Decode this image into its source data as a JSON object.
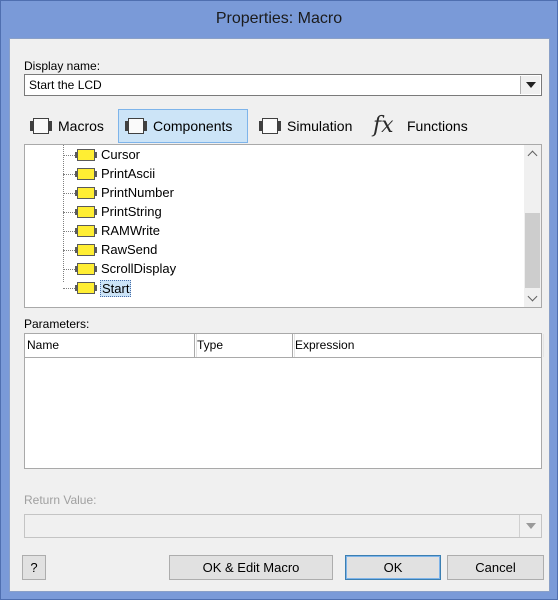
{
  "window": {
    "title": "Properties: Macro"
  },
  "display_name": {
    "label": "Display name:",
    "value": "Start the LCD"
  },
  "tabs": [
    {
      "label": "Macros",
      "icon": "component-icon",
      "active": false
    },
    {
      "label": "Components",
      "icon": "component-icon",
      "active": true
    },
    {
      "label": "Simulation",
      "icon": "component-icon",
      "active": false
    },
    {
      "label": "Functions",
      "icon": "fx-icon",
      "active": false
    }
  ],
  "tree": {
    "items": [
      {
        "label": "Cursor",
        "selected": false
      },
      {
        "label": "PrintAscii",
        "selected": false
      },
      {
        "label": "PrintNumber",
        "selected": false
      },
      {
        "label": "PrintString",
        "selected": false
      },
      {
        "label": "RAMWrite",
        "selected": false
      },
      {
        "label": "RawSend",
        "selected": false
      },
      {
        "label": "ScrollDisplay",
        "selected": false
      },
      {
        "label": "Start",
        "selected": true
      }
    ]
  },
  "parameters": {
    "label": "Parameters:",
    "columns": [
      "Name",
      "Type",
      "Expression"
    ]
  },
  "return_value": {
    "label": "Return Value:",
    "value": ""
  },
  "buttons": {
    "help": "?",
    "ok_edit": "OK & Edit Macro",
    "ok": "OK",
    "cancel": "Cancel"
  },
  "colors": {
    "accent": "#cce4f7",
    "frame": "#7a9ad8",
    "macro_icon": "#ffee33"
  }
}
